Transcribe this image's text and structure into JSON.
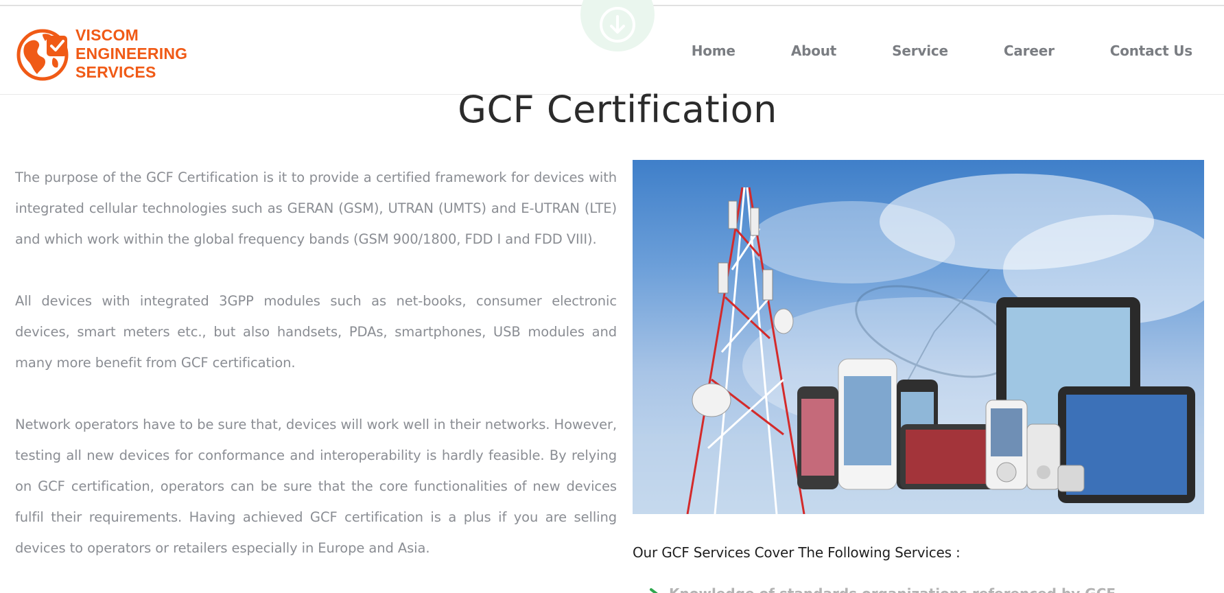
{
  "brand": {
    "logo_lines": [
      "VISCOM",
      "ENGINEERING",
      "SERVICES"
    ],
    "logo_color": "#f05a16",
    "logo_icon": "globe-check-icon"
  },
  "nav": {
    "items": [
      {
        "label": "Home"
      },
      {
        "label": "About"
      },
      {
        "label": "Service"
      },
      {
        "label": "Career"
      },
      {
        "label": "Contact Us"
      }
    ]
  },
  "scroll_badge": {
    "icon": "download-circle-icon",
    "color": "#eaf6ee"
  },
  "page": {
    "title": "GCF Certification",
    "paragraphs": [
      "The purpose of the GCF Certification is it to provide a certified framework for devices with integrated cellular technologies such as GERAN (GSM), UTRAN (UMTS) and E-UTRAN (LTE) and which work within the global frequency bands (GSM 900/1800, FDD I and FDD VIII).",
      "All devices with integrated 3GPP modules such as net-books, consumer electronic devices, smart meters etc., but also handsets, PDAs, smartphones, USB modules and many more benefit from GCF certification.",
      "Network operators have to be sure that, devices will work well in their networks. However, testing all new devices for conformance and interoperability is hardly feasible. By relying on GCF certification, operators can be sure that the core functionalities of new devices fulfil their requirements. Having achieved GCF certification is a plus if you are selling devices to operators or retailers especially in Europe and Asia."
    ],
    "services_heading": "Our GCF Services Cover The Following Services :",
    "services": [
      "Knowledge of standards organizations referenced by GCF"
    ]
  },
  "colors": {
    "nav_text": "#7a7d82",
    "body_text": "#8a8d93",
    "title_text": "#2b2b2b",
    "accent_green": "#2fa84f"
  }
}
